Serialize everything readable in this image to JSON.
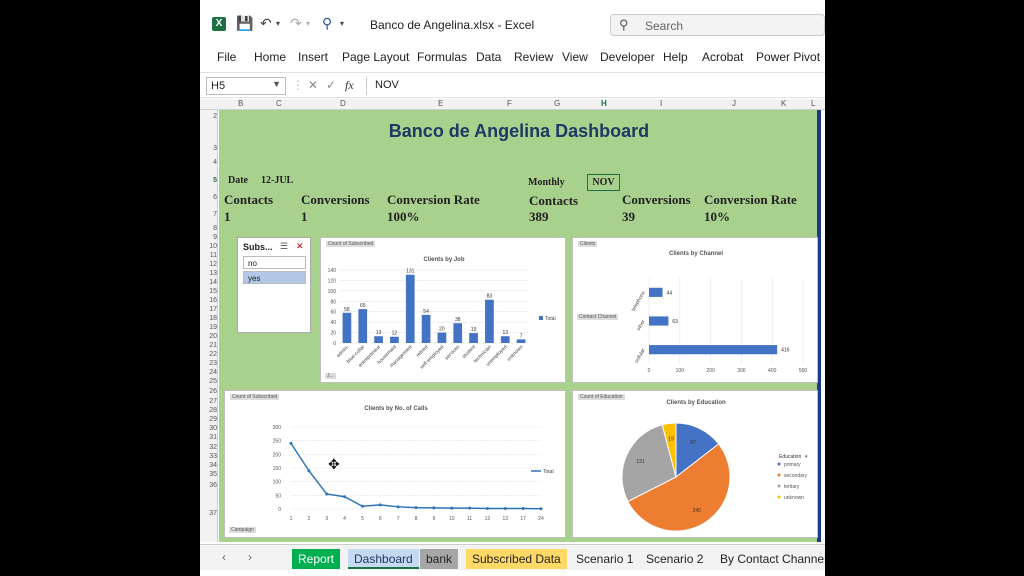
{
  "window": {
    "file_title": "Banco de Angelina.xlsx",
    "app": "Excel",
    "separator": "-",
    "search_placeholder": "Search"
  },
  "menu": [
    "File",
    "Home",
    "Insert",
    "Page Layout",
    "Formulas",
    "Data",
    "Review",
    "View",
    "Developer",
    "Help",
    "Acrobat",
    "Power Pivot"
  ],
  "formula_bar": {
    "cell_ref": "H5",
    "value": "NOV",
    "fx": "fx"
  },
  "columns": [
    "B",
    "C",
    "D",
    "E",
    "F",
    "G",
    "H",
    "I",
    "J",
    "K",
    "L"
  ],
  "rows": [
    "2",
    "3",
    "4",
    "5",
    "6",
    "7",
    "8",
    "9",
    "10",
    "11",
    "12",
    "13",
    "14",
    "15",
    "16",
    "17",
    "18",
    "19",
    "20",
    "21",
    "22",
    "23",
    "24",
    "25",
    "26",
    "27",
    "28",
    "29",
    "30",
    "31",
    "32",
    "33",
    "34",
    "35",
    "36",
    "37"
  ],
  "dashboard": {
    "title": "Banco de Angelina Dashboard",
    "date_label": "Date",
    "date_value": "12-JUL",
    "monthly_label": "Monthly",
    "month_value": "NOV",
    "left": {
      "contacts_label": "Contacts",
      "contacts": "1",
      "conv_label": "Conversions",
      "conv": "1",
      "rate_label": "Conversion Rate",
      "rate": "100%"
    },
    "right": {
      "contacts_label": "Contacts",
      "contacts": "389",
      "conv_label": "Conversions",
      "conv": "39",
      "rate_label": "Conversion Rate",
      "rate": "10%"
    }
  },
  "slicer": {
    "header": "Subs...",
    "items": [
      "no",
      "yes"
    ],
    "selected": "yes"
  },
  "chart_tags": {
    "job": "Count of Subscribed",
    "job_filter": "J...",
    "channel": "Clients",
    "channel_filter": "Contact Channel",
    "calls": "Count of Subscribed",
    "calls_filter": "Campaign",
    "edu": "Count of Education"
  },
  "chart_data": [
    {
      "type": "bar",
      "title": "Clients by Job",
      "categories": [
        "admin.",
        "blue-collar",
        "entrepreneur",
        "housemaid",
        "management",
        "retired",
        "self-employed",
        "services",
        "student",
        "technician",
        "unemployed",
        "unknown"
      ],
      "series": [
        {
          "name": "Total",
          "values": [
            58,
            65,
            13,
            12,
            131,
            54,
            20,
            38,
            19,
            83,
            13,
            7
          ]
        }
      ],
      "ylim": [
        0,
        140
      ],
      "yticks": [
        0,
        20,
        40,
        60,
        80,
        100,
        120,
        140
      ]
    },
    {
      "type": "bar",
      "orientation": "horizontal",
      "title": "Clients by Channel",
      "categories": [
        "telephone",
        "other",
        "cellular"
      ],
      "values": [
        44,
        63,
        416
      ],
      "xlim": [
        0,
        500
      ],
      "xticks": [
        0,
        100,
        200,
        300,
        400,
        500
      ]
    },
    {
      "type": "line",
      "title": "Clients by No. of Calls",
      "x": [
        1,
        2,
        3,
        4,
        5,
        6,
        7,
        8,
        9,
        10,
        11,
        12,
        13,
        17,
        24
      ],
      "series": [
        {
          "name": "Total",
          "values": [
            240,
            140,
            55,
            45,
            10,
            15,
            8,
            5,
            4,
            3,
            3,
            2,
            2,
            2,
            1
          ]
        }
      ],
      "ylim": [
        0,
        300
      ],
      "yticks": [
        0,
        50,
        100,
        150,
        200,
        250,
        300
      ]
    },
    {
      "type": "pie",
      "title": "Clients by Education",
      "legend_title": "Education",
      "slices": [
        {
          "label": "primary",
          "value": 67,
          "color": "#4472c4"
        },
        {
          "label": "secondary",
          "value": 245,
          "color": "#ed7d31"
        },
        {
          "label": "tertiary",
          "value": 131,
          "color": "#a5a5a5"
        },
        {
          "label": "unknown",
          "value": 19,
          "color": "#ffc000"
        }
      ]
    }
  ],
  "sheet_tabs": [
    {
      "label": "Report",
      "bg": "#00b050",
      "fg": "#ffffff"
    },
    {
      "label": "Dashboard",
      "bg": "#c5d9f1",
      "fg": "#1f3864"
    },
    {
      "label": "bank",
      "bg": "#a6a6a6",
      "fg": "#222222"
    },
    {
      "label": "Subscribed Data",
      "bg": "#ffd966",
      "fg": "#222222"
    },
    {
      "label": "Scenario 1",
      "bg": "",
      "fg": "#222222"
    },
    {
      "label": "Scenario 2",
      "bg": "",
      "fg": "#222222"
    },
    {
      "label": "By Contact Channel",
      "bg": "",
      "fg": "#222222"
    }
  ]
}
